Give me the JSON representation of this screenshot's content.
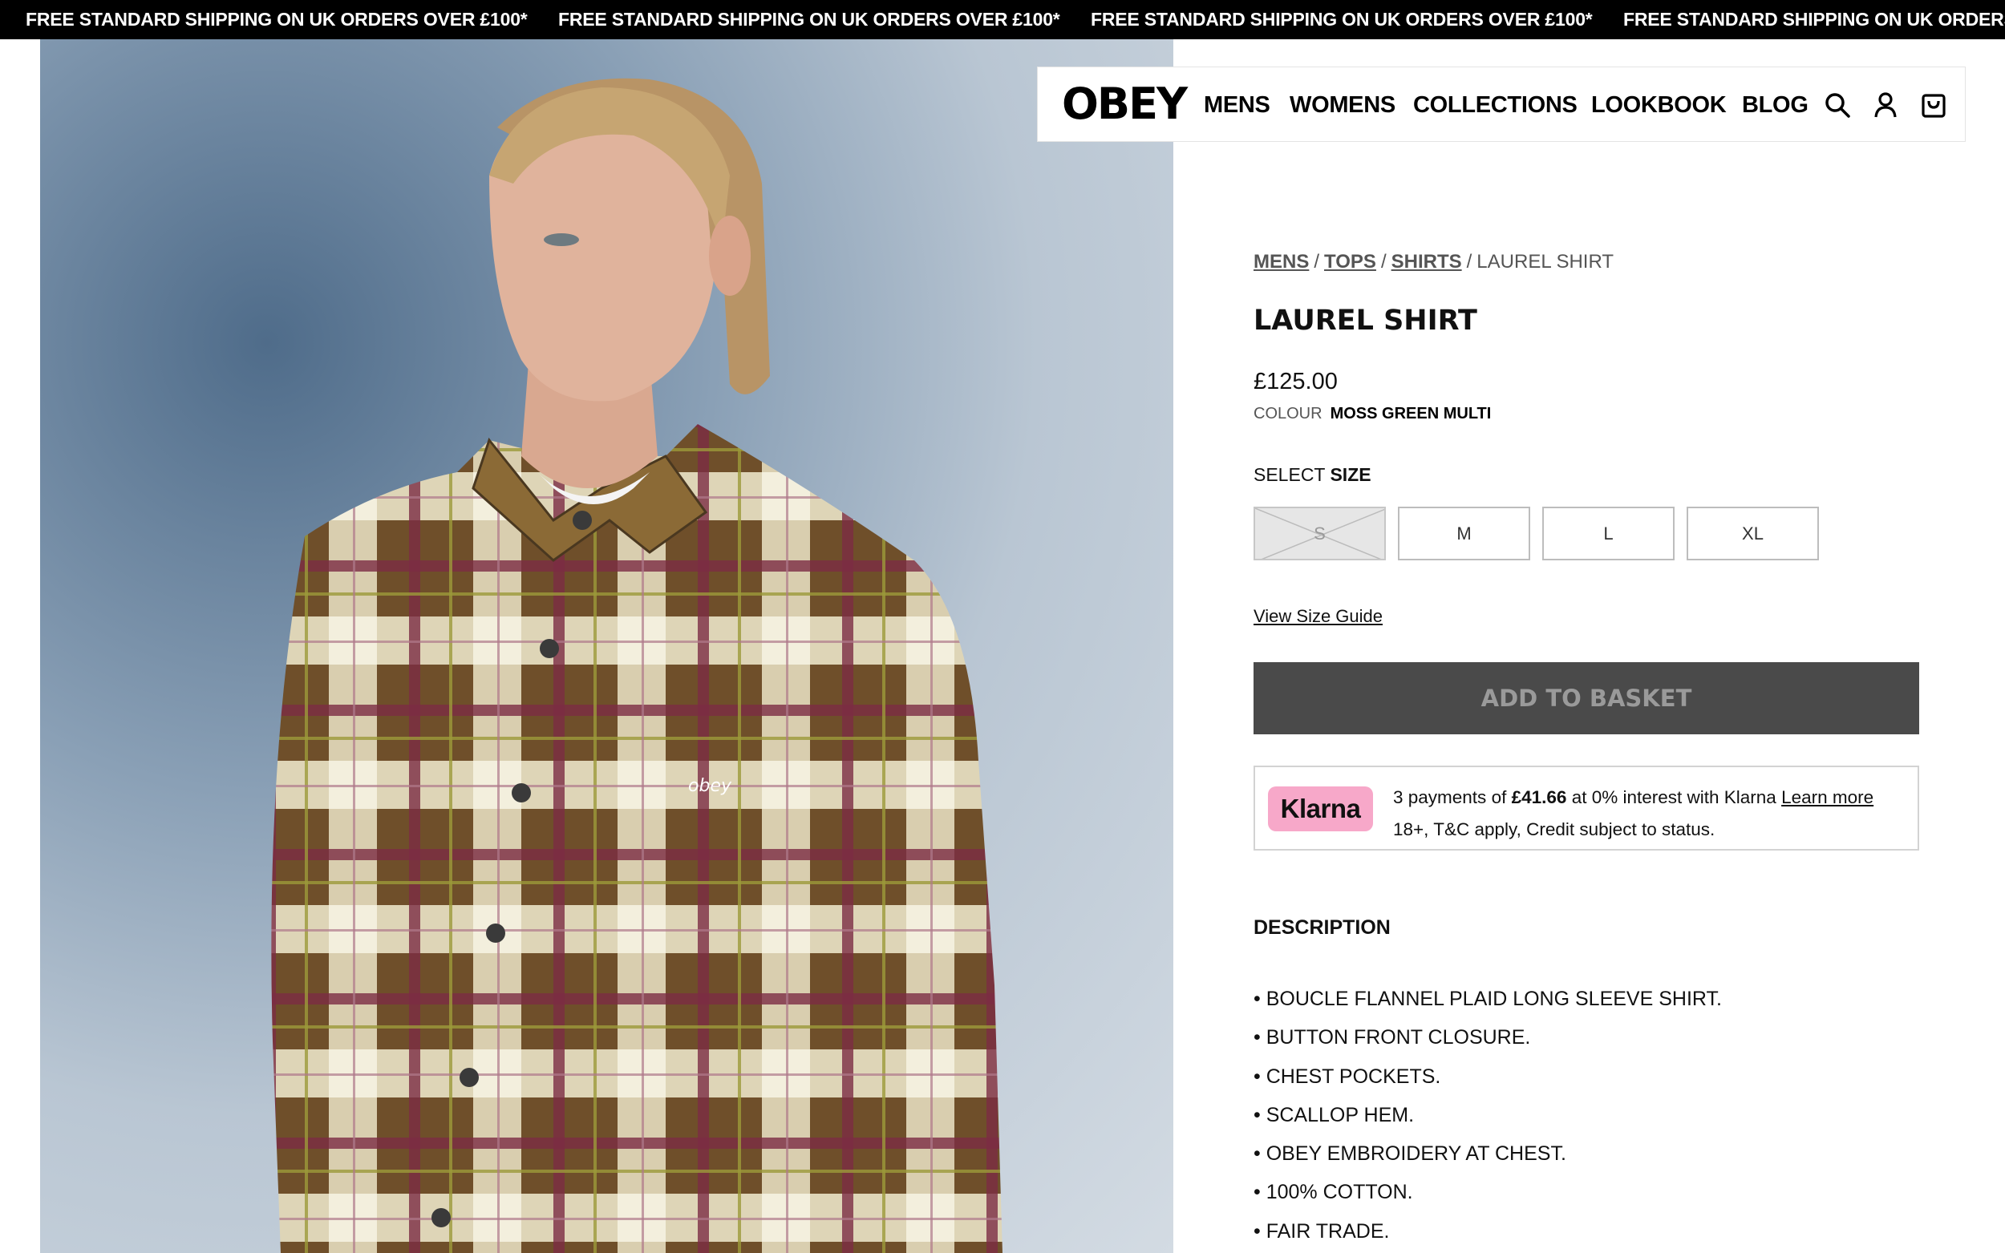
{
  "announcement": {
    "text": "FREE STANDARD SHIPPING ON UK ORDERS OVER £100*"
  },
  "header": {
    "logo": "OBEY",
    "nav": [
      "MENS",
      "WOMENS",
      "COLLECTIONS",
      "LOOKBOOK",
      "BLOG"
    ],
    "icons": [
      "search-icon",
      "account-icon",
      "basket-icon"
    ]
  },
  "product_image": {
    "description_icon": "product-photo",
    "chest_embroidery": "obey"
  },
  "breadcrumb": {
    "items": [
      "MENS",
      "TOPS",
      "SHIRTS"
    ],
    "separator": "/",
    "current": "LAUREL SHIRT"
  },
  "product": {
    "title": "LAUREL SHIRT",
    "price": "£125.00",
    "colour_label": "COLOUR",
    "colour_value": "MOSS GREEN MULTI"
  },
  "size": {
    "label_prefix": "SELECT",
    "label_strong": "SIZE",
    "options": [
      {
        "label": "S",
        "available": false
      },
      {
        "label": "M",
        "available": true
      },
      {
        "label": "L",
        "available": true
      },
      {
        "label": "XL",
        "available": true
      }
    ],
    "guide_link": "View Size Guide"
  },
  "add_to_basket": "ADD TO BASKET",
  "klarna": {
    "badge": "Klarna",
    "line1_prefix": "3 payments of",
    "amount": "£41.66",
    "line1_suffix": "at 0% interest with Klarna",
    "learn_more": "Learn more",
    "line2": "18+, T&C apply, Credit subject to status."
  },
  "description": {
    "heading": "DESCRIPTION",
    "bullets": [
      "• BOUCLE FLANNEL PLAID LONG SLEEVE SHIRT.",
      "• BUTTON FRONT CLOSURE.",
      "• CHEST POCKETS.",
      "• SCALLOP HEM.",
      "• OBEY EMBROIDERY AT CHEST.",
      "• 100% COTTON.",
      "• FAIR TRADE."
    ]
  },
  "colors": {
    "announcement_bg": "#000000",
    "basket_bg": "#4a4a4a",
    "klarna_pink": "#f7a8c9",
    "shirt_brown": "#7a5a2e",
    "shirt_maroon": "#7a2a3a",
    "shirt_cream": "#e8e0c4"
  }
}
